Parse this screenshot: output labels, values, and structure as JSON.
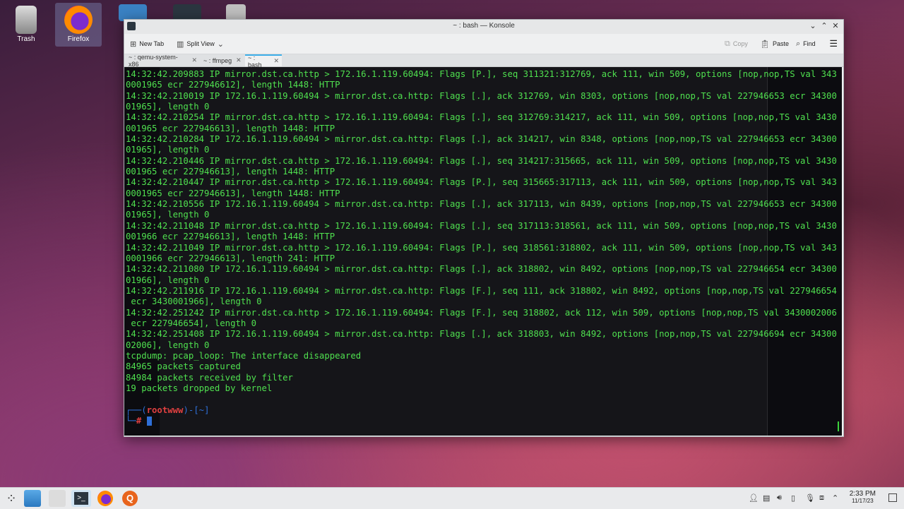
{
  "desktop": {
    "icons": [
      {
        "label": "Trash"
      },
      {
        "label": "Firefox"
      }
    ]
  },
  "window": {
    "title": "~ : bash — Konsole",
    "toolbar": {
      "new_tab": "New Tab",
      "split_view": "Split View",
      "copy": "Copy",
      "paste": "Paste",
      "find": "Find"
    },
    "tabs": [
      {
        "label": "~ : qemu-system-x86"
      },
      {
        "label": "~ : ffmpeg"
      },
      {
        "label": "~ : bash"
      }
    ]
  },
  "terminal": {
    "lines": [
      "14:32:42.209883 IP mirror.dst.ca.http > 172.16.1.119.60494: Flags [P.], seq 311321:312769, ack 111, win 509, options [nop,nop,TS val 343",
      "0001965 ecr 227946612], length 1448: HTTP",
      "14:32:42.210019 IP 172.16.1.119.60494 > mirror.dst.ca.http: Flags [.], ack 312769, win 8303, options [nop,nop,TS val 227946653 ecr 34300",
      "01965], length 0",
      "14:32:42.210254 IP mirror.dst.ca.http > 172.16.1.119.60494: Flags [.], seq 312769:314217, ack 111, win 509, options [nop,nop,TS val 3430",
      "001965 ecr 227946613], length 1448: HTTP",
      "14:32:42.210284 IP 172.16.1.119.60494 > mirror.dst.ca.http: Flags [.], ack 314217, win 8348, options [nop,nop,TS val 227946653 ecr 34300",
      "01965], length 0",
      "14:32:42.210446 IP mirror.dst.ca.http > 172.16.1.119.60494: Flags [.], seq 314217:315665, ack 111, win 509, options [nop,nop,TS val 3430",
      "001965 ecr 227946613], length 1448: HTTP",
      "14:32:42.210447 IP mirror.dst.ca.http > 172.16.1.119.60494: Flags [P.], seq 315665:317113, ack 111, win 509, options [nop,nop,TS val 343",
      "0001965 ecr 227946613], length 1448: HTTP",
      "14:32:42.210556 IP 172.16.1.119.60494 > mirror.dst.ca.http: Flags [.], ack 317113, win 8439, options [nop,nop,TS val 227946653 ecr 34300",
      "01965], length 0",
      "14:32:42.211048 IP mirror.dst.ca.http > 172.16.1.119.60494: Flags [.], seq 317113:318561, ack 111, win 509, options [nop,nop,TS val 3430",
      "001966 ecr 227946613], length 1448: HTTP",
      "14:32:42.211049 IP mirror.dst.ca.http > 172.16.1.119.60494: Flags [P.], seq 318561:318802, ack 111, win 509, options [nop,nop,TS val 343",
      "0001966 ecr 227946613], length 241: HTTP",
      "14:32:42.211080 IP 172.16.1.119.60494 > mirror.dst.ca.http: Flags [.], ack 318802, win 8492, options [nop,nop,TS val 227946654 ecr 34300",
      "01966], length 0",
      "14:32:42.211916 IP 172.16.1.119.60494 > mirror.dst.ca.http: Flags [F.], seq 111, ack 318802, win 8492, options [nop,nop,TS val 227946654",
      " ecr 3430001966], length 0",
      "14:32:42.251242 IP mirror.dst.ca.http > 172.16.1.119.60494: Flags [F.], seq 318802, ack 112, win 509, options [nop,nop,TS val 3430002006",
      " ecr 227946654], length 0",
      "14:32:42.251408 IP 172.16.1.119.60494 > mirror.dst.ca.http: Flags [.], ack 318803, win 8492, options [nop,nop,TS val 227946694 ecr 34300",
      "02006], length 0",
      "tcpdump: pcap_loop: The interface disappeared",
      "84965 packets captured",
      "84984 packets received by filter",
      "19 packets dropped by kernel",
      ""
    ],
    "prompt": {
      "open": "┌──(",
      "user": "rootwww",
      "close": ")-[~]",
      "corner": "└─",
      "hash": "#"
    }
  },
  "taskbar": {
    "time": "2:33 PM",
    "date": "11/17/23"
  },
  "colors": {
    "terminal_fg": "#4fe04f",
    "terminal_bg": "#0c0c10",
    "prompt_blue": "#2e6fd8",
    "prompt_red": "#e04040",
    "active_tab_accent": "#3daee9"
  }
}
